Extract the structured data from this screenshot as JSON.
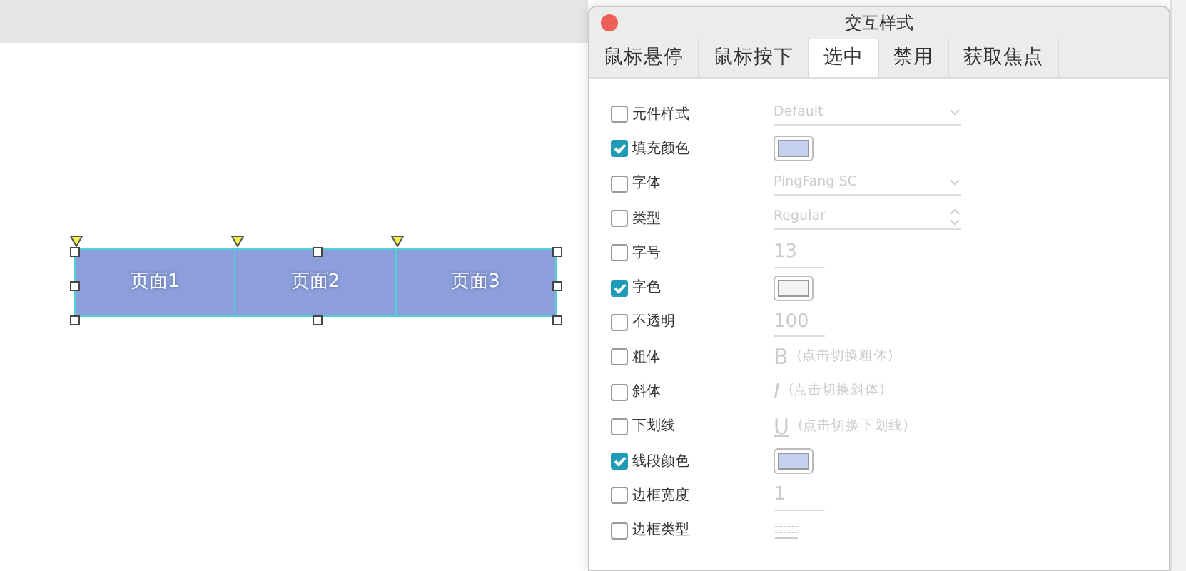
{
  "canvas": {
    "widget_tabs": [
      {
        "label": "页面1"
      },
      {
        "label": "页面2"
      },
      {
        "label": "页面3"
      }
    ]
  },
  "dialog": {
    "title": "交互样式",
    "tabs": [
      {
        "label": "鼠标悬停",
        "selected": false
      },
      {
        "label": "鼠标按下",
        "selected": false
      },
      {
        "label": "选中",
        "selected": true
      },
      {
        "label": "禁用",
        "selected": false
      },
      {
        "label": "获取焦点",
        "selected": false
      }
    ],
    "properties": [
      {
        "label": "元件样式",
        "checked": false,
        "kind": "dropdown",
        "value": "Default"
      },
      {
        "label": "填充颜色",
        "checked": true,
        "kind": "swatch",
        "color": "#c5d0f0"
      },
      {
        "label": "字体",
        "checked": false,
        "kind": "dropdown",
        "value": "PingFang SC"
      },
      {
        "label": "类型",
        "checked": false,
        "kind": "stepper",
        "value": "Regular"
      },
      {
        "label": "字号",
        "checked": false,
        "kind": "number",
        "value": "13"
      },
      {
        "label": "字色",
        "checked": true,
        "kind": "swatch",
        "color": "#f4f4f4"
      },
      {
        "label": "不透明",
        "checked": false,
        "kind": "number",
        "value": "100"
      },
      {
        "label": "粗体",
        "checked": false,
        "kind": "toggle",
        "glyph": "B",
        "hint": "(点击切换粗体)"
      },
      {
        "label": "斜体",
        "checked": false,
        "kind": "toggle",
        "glyph": "I",
        "hint": "(点击切换斜体)"
      },
      {
        "label": "下划线",
        "checked": false,
        "kind": "toggle",
        "glyph": "U",
        "hint": "(点击切换下划线)"
      },
      {
        "label": "线段颜色",
        "checked": true,
        "kind": "swatch",
        "color": "#c5d0f0"
      },
      {
        "label": "边框宽度",
        "checked": false,
        "kind": "number",
        "value": "1"
      },
      {
        "label": "边框类型",
        "checked": false,
        "kind": "linestyle"
      }
    ]
  }
}
